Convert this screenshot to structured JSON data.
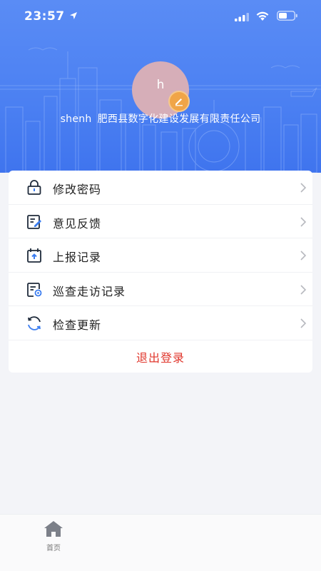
{
  "status_bar": {
    "time": "23:57"
  },
  "profile": {
    "avatar_letter": "h",
    "username": "shenh",
    "company": "肥西县数字化建设发展有限责任公司"
  },
  "menu": {
    "items": [
      {
        "label": "修改密码",
        "icon": "lock-icon"
      },
      {
        "label": "意见反馈",
        "icon": "feedback-edit-icon"
      },
      {
        "label": "上报记录",
        "icon": "upload-record-icon"
      },
      {
        "label": "巡查走访记录",
        "icon": "inspection-record-icon"
      },
      {
        "label": "检查更新",
        "icon": "refresh-icon"
      }
    ],
    "logout_label": "退出登录"
  },
  "tabbar": {
    "home_label": "首页"
  },
  "colors": {
    "header_blue": "#4b80f2",
    "logout_red": "#e0352b",
    "edit_badge": "#f0a548",
    "avatar": "#d6aeb8"
  }
}
